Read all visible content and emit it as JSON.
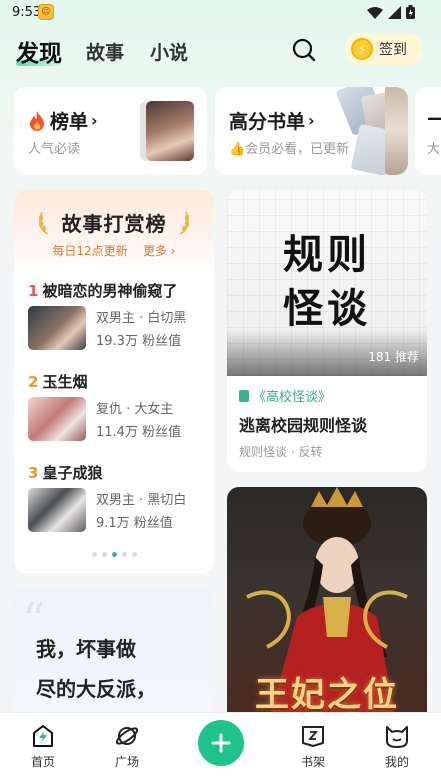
{
  "status_bar": {
    "time": "9:53"
  },
  "header": {
    "tabs": [
      {
        "label": "发现"
      },
      {
        "label": "故事"
      },
      {
        "label": "小说"
      }
    ],
    "checkin_label": "签到"
  },
  "top_cards": [
    {
      "title": "榜单",
      "subtitle": "人气必读"
    },
    {
      "title": "高分书单",
      "subtitle": "👍会员必看，已更新"
    },
    {
      "title": "—",
      "subtitle": "大"
    }
  ],
  "story_rank": {
    "title": "故事打赏榜",
    "subtitle": "每日12点更新",
    "more_label": "更多 ›",
    "items": [
      {
        "rank": "1",
        "name": "被暗恋的男神偷窥了",
        "tags": "双男主 · 白切黑",
        "fans": "19.3万 粉丝值"
      },
      {
        "rank": "2",
        "name": "玉生烟",
        "tags": "复仇 · 大女主",
        "fans": "11.4万 粉丝值"
      },
      {
        "rank": "3",
        "name": "皇子成狼",
        "tags": "双男主 · 黑切白",
        "fans": "9.1万 粉丝值"
      }
    ]
  },
  "rule_card": {
    "cover_text_line1": "规则",
    "cover_text_line2": "怪谈",
    "recommend_count": "181 推荐",
    "series": "《高校怪谈》",
    "name": "逃离校园规则怪谈",
    "tags": "规则怪谈 · 反转"
  },
  "queen_card": {
    "cover_text": "王妃之位"
  },
  "quote_card": {
    "line1": "我，坏事做",
    "line2": "尽的大反派，"
  },
  "bottom_nav": {
    "items": [
      {
        "label": "首页"
      },
      {
        "label": "广场"
      },
      {
        "label": "书架"
      },
      {
        "label": "我的"
      }
    ]
  }
}
